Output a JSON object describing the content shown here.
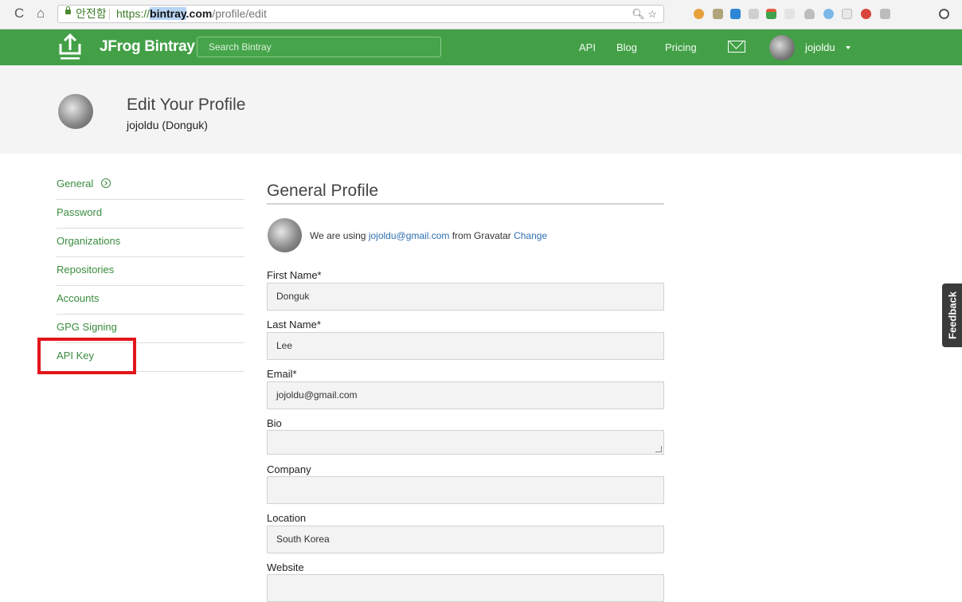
{
  "browser": {
    "secure_label": "안전함",
    "url_scheme": "https://",
    "url_host": "bintray",
    "url_host_rest": ".com",
    "url_path": "/profile/edit"
  },
  "header": {
    "brand": "JFrog Bintray",
    "search_placeholder": "Search Bintray",
    "nav": [
      "API",
      "Blog",
      "Pricing"
    ],
    "username": "jojoldu"
  },
  "profile_header": {
    "title": "Edit Your Profile",
    "subtitle": "jojoldu (Donguk)"
  },
  "sidebar": {
    "items": [
      {
        "label": "General"
      },
      {
        "label": "Password"
      },
      {
        "label": "Organizations"
      },
      {
        "label": "Repositories"
      },
      {
        "label": "Accounts"
      },
      {
        "label": "GPG Signing"
      },
      {
        "label": "API Key"
      }
    ]
  },
  "main": {
    "title": "General Profile",
    "gravatar": {
      "prefix": "We are using ",
      "email": "jojoldu@gmail.com",
      "middle": " from Gravatar ",
      "change": "Change"
    },
    "fields": [
      {
        "label": "First Name*",
        "value": "Donguk"
      },
      {
        "label": "Last Name*",
        "value": "Lee"
      },
      {
        "label": "Email*",
        "value": "jojoldu@gmail.com"
      },
      {
        "label": "Bio",
        "value": ""
      },
      {
        "label": "Company",
        "value": ""
      },
      {
        "label": "Location",
        "value": "South Korea"
      },
      {
        "label": "Website",
        "value": ""
      }
    ]
  },
  "feedback_label": "Feedback",
  "colors": {
    "brand_green": "#43a047",
    "link_green": "#3a8c3e",
    "highlight_red": "#e2151b"
  }
}
